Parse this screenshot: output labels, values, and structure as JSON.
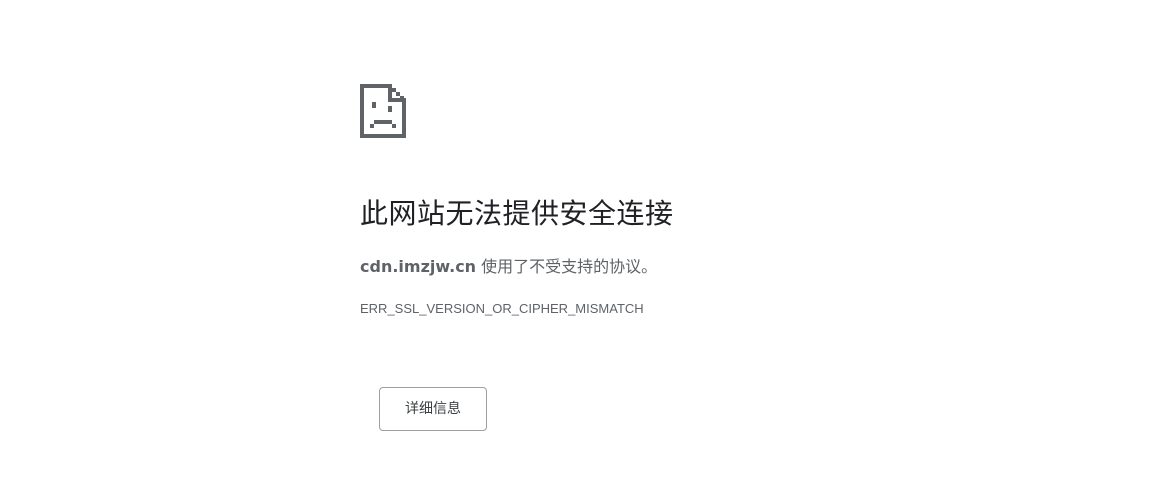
{
  "error_page": {
    "icon": "sad-file-icon",
    "heading": "此网站无法提供安全连接",
    "host": "cdn.imzjw.cn",
    "summary_text": " 使用了不受支持的协议。",
    "error_code": "ERR_SSL_VERSION_OR_CIPHER_MISMATCH",
    "details_button_label": "详细信息"
  },
  "colors": {
    "heading": "#202124",
    "body_text": "#5f6368",
    "icon": "#5f6368",
    "button_border": "#9aa0a6"
  }
}
